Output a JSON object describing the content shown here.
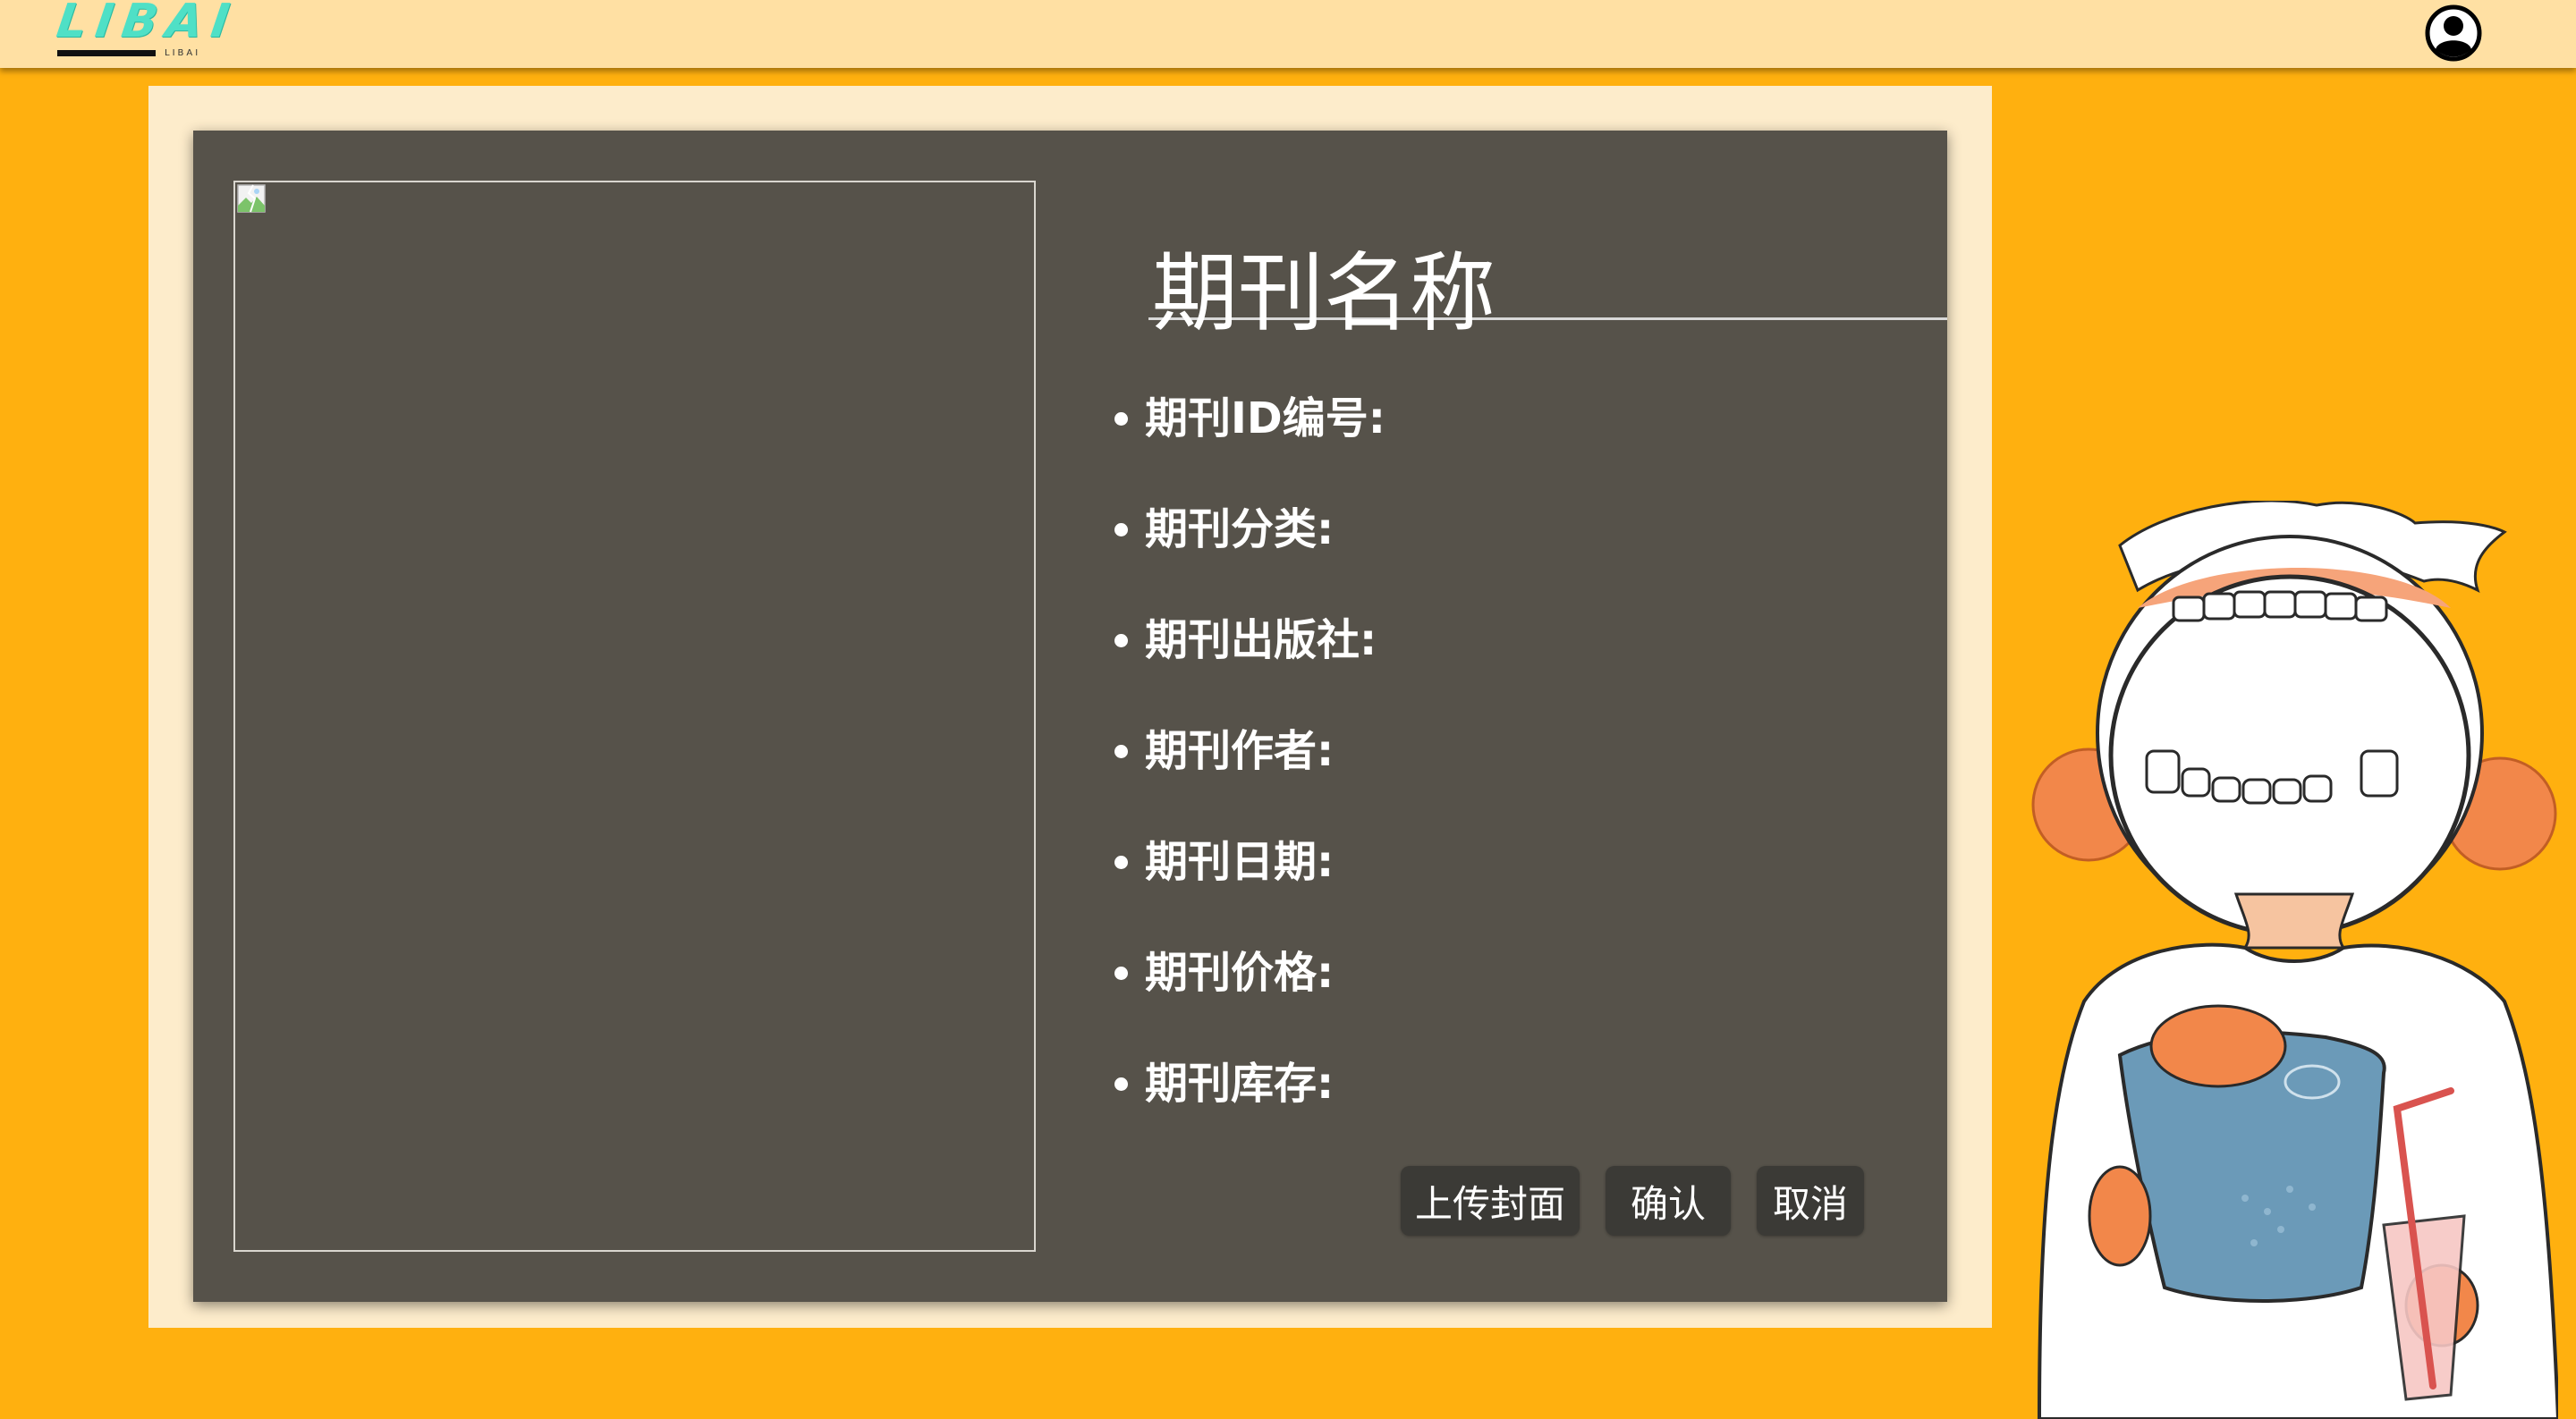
{
  "header": {
    "logo_text": "LIBAI",
    "logo_subtext": "LIBAI",
    "avatar_icon": "user-circle-icon"
  },
  "form": {
    "cover_icon": "broken-image-icon",
    "title": "期刊名称",
    "fields": [
      {
        "label": "期刊ID编号:"
      },
      {
        "label": "期刊分类:"
      },
      {
        "label": "期刊出版社:"
      },
      {
        "label": "期刊作者:"
      },
      {
        "label": "期刊日期:"
      },
      {
        "label": "期刊价格:"
      },
      {
        "label": "期刊库存:"
      }
    ],
    "buttons": {
      "upload": "上传封面",
      "confirm": "确认",
      "cancel": "取消"
    }
  },
  "colors": {
    "background": "#ffb00f",
    "topbar": "#ffe0a3",
    "panel_outer": "#fdeccb",
    "panel": "#56524a",
    "button": "#3b3a36",
    "logo": "#4fe0c6"
  }
}
